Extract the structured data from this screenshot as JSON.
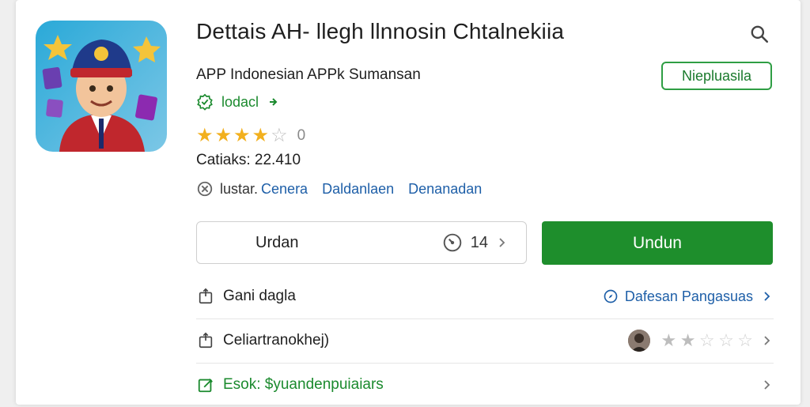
{
  "header": {
    "title": "Dettais AH- llegh llnnosin Chtalnekiia",
    "developer": "APP  Indonesian APPk Sumansan",
    "follow_label": "Niepluasila"
  },
  "badge": {
    "label": "lodacl"
  },
  "rating": {
    "stars": [
      1,
      1,
      1,
      1,
      0
    ],
    "count_text": "0"
  },
  "downloads": "Catiaks: 22.410",
  "tags": {
    "label": "lustar.",
    "items": [
      "Cenera",
      "Daldanlaen",
      "Denanadan"
    ]
  },
  "version_box": {
    "label": "Urdan",
    "value": "14"
  },
  "install_label": "Undun",
  "rows": [
    {
      "label": "Gani dagla",
      "right_link": "Dafesan Pangasuas"
    },
    {
      "label": "Celiartranokhej)",
      "stars": [
        1,
        1,
        0,
        0,
        0
      ]
    },
    {
      "label": "Esok: $yuandenpuiaiars"
    }
  ],
  "colors": {
    "accent_green": "#1e8e2c",
    "link_blue": "#1e5fa8",
    "star_gold": "#f2b01e"
  },
  "icons": [
    "app-icon",
    "search-icon",
    "verified-badge-icon",
    "arrow-right-icon",
    "tag-icon",
    "speedometer-icon",
    "chevron-right-icon",
    "share-icon",
    "compass-icon",
    "edit-icon"
  ]
}
